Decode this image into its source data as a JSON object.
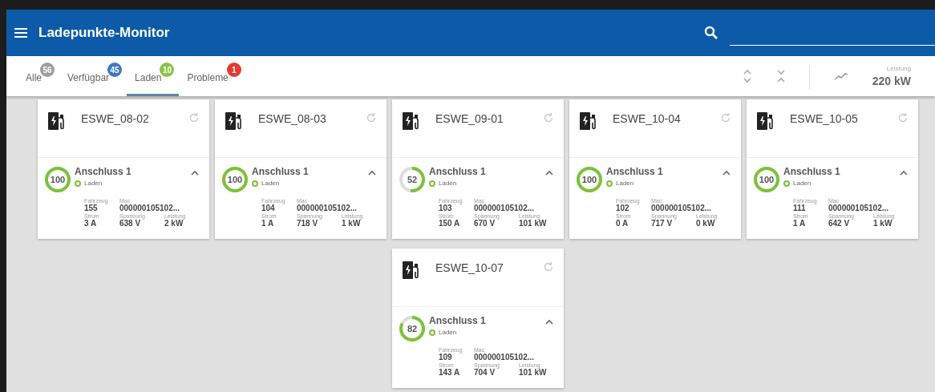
{
  "app_bar": {
    "title": "Ladepunkte-Monitor"
  },
  "tabs": [
    {
      "label": "Alle",
      "count": "56",
      "color": "#9e9e9e",
      "selected": false
    },
    {
      "label": "Verfügbar",
      "count": "45",
      "color": "#3f78c0",
      "selected": false
    },
    {
      "label": "Laden",
      "count": "10",
      "color": "#8bc34a",
      "selected": true
    },
    {
      "label": "Probleme",
      "count": "1",
      "color": "#e53935",
      "selected": false
    }
  ],
  "summary": {
    "label": "Leistung",
    "value": "220 kW"
  },
  "stations": [
    {
      "name": "ESWE_08-02",
      "connector": {
        "percent": "100",
        "level": 1,
        "title": "Anschluss 1",
        "status": "Laden",
        "fields": [
          {
            "label": "Fahrzeug",
            "value": "155"
          },
          {
            "label": "Mac",
            "value": "000000105102..."
          },
          {
            "label": "Strom",
            "value": "3 A"
          },
          {
            "label": "Spannung",
            "value": "638 V"
          },
          {
            "label": "Leistung",
            "value": "2 kW"
          }
        ]
      }
    },
    {
      "name": "ESWE_08-03",
      "connector": {
        "percent": "100",
        "level": 1,
        "title": "Anschluss 1",
        "status": "Laden",
        "fields": [
          {
            "label": "Fahrzeug",
            "value": "104"
          },
          {
            "label": "Mac",
            "value": "000000105102..."
          },
          {
            "label": "Strom",
            "value": "1 A"
          },
          {
            "label": "Spannung",
            "value": "718 V"
          },
          {
            "label": "Leistung",
            "value": "1 kW"
          }
        ]
      }
    },
    {
      "name": "ESWE_09-01",
      "connector": {
        "percent": "52",
        "level": 0.52,
        "title": "Anschluss 1",
        "status": "Laden",
        "fields": [
          {
            "label": "Fahrzeug",
            "value": "103"
          },
          {
            "label": "Mac",
            "value": "000000105102..."
          },
          {
            "label": "Strom",
            "value": "150 A"
          },
          {
            "label": "Spannung",
            "value": "670 V"
          },
          {
            "label": "Leistung",
            "value": "101 kW"
          }
        ]
      }
    },
    {
      "name": "ESWE_10-04",
      "connector": {
        "percent": "100",
        "level": 1,
        "title": "Anschluss 1",
        "status": "Laden",
        "fields": [
          {
            "label": "Fahrzeug",
            "value": "102"
          },
          {
            "label": "Mac",
            "value": "000000105102..."
          },
          {
            "label": "Strom",
            "value": "0 A"
          },
          {
            "label": "Spannung",
            "value": "717 V"
          },
          {
            "label": "Leistung",
            "value": "0 kW"
          }
        ]
      }
    },
    {
      "name": "ESWE_10-05",
      "connector": {
        "percent": "100",
        "level": 1,
        "title": "Anschluss 1",
        "status": "Laden",
        "fields": [
          {
            "label": "Fahrzeug",
            "value": "111"
          },
          {
            "label": "Mac",
            "value": "000000105102..."
          },
          {
            "label": "Strom",
            "value": "1 A"
          },
          {
            "label": "Spannung",
            "value": "642 V"
          },
          {
            "label": "Leistung",
            "value": "1 kW"
          }
        ]
      }
    },
    {
      "name": "ESWE_10-07",
      "connector": {
        "percent": "82",
        "level": 0.82,
        "title": "Anschluss 1",
        "status": "Laden",
        "fields": [
          {
            "label": "Fahrzeug",
            "value": "109"
          },
          {
            "label": "Mac",
            "value": "000000105102..."
          },
          {
            "label": "Strom",
            "value": "143 A"
          },
          {
            "label": "Spannung",
            "value": "704 V"
          },
          {
            "label": "Leistung",
            "value": "101 kW"
          }
        ]
      }
    }
  ]
}
